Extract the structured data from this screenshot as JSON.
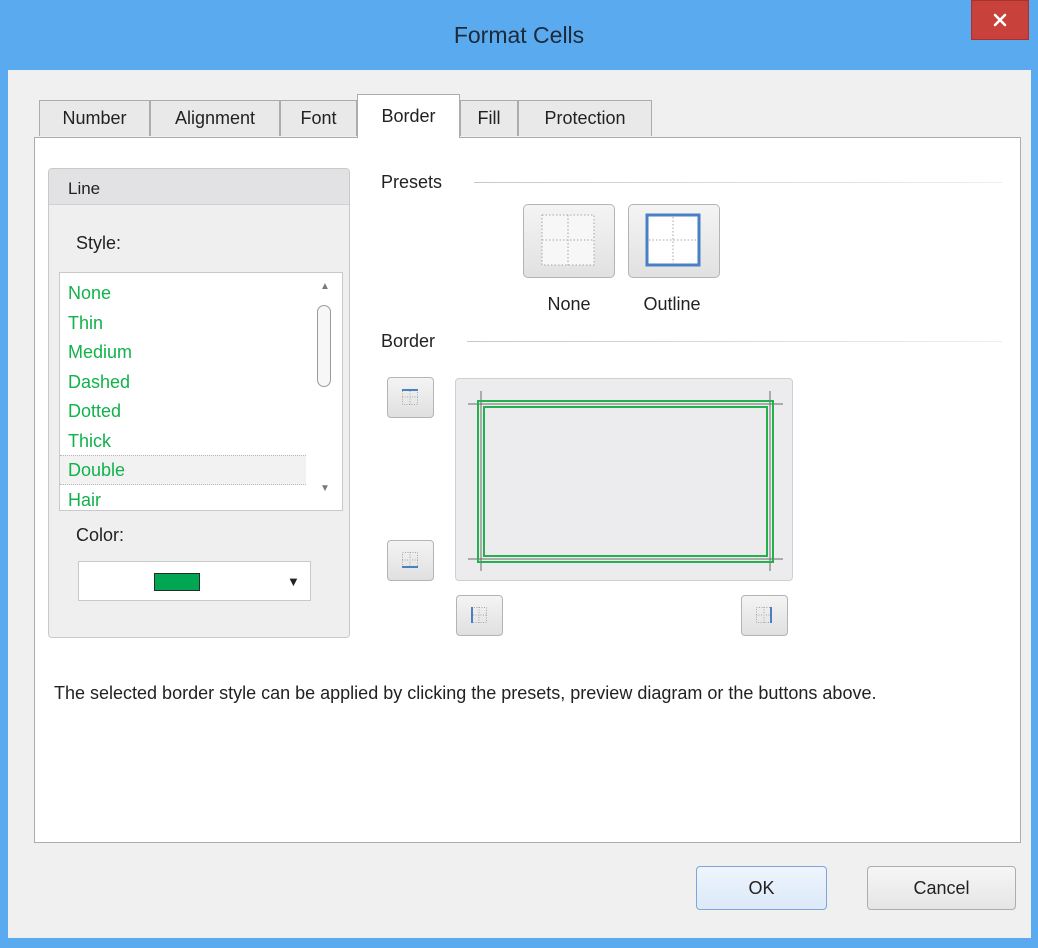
{
  "window": {
    "title": "Format Cells"
  },
  "tabs": [
    {
      "label": "Number"
    },
    {
      "label": "Alignment"
    },
    {
      "label": "Font"
    },
    {
      "label": "Border"
    },
    {
      "label": "Fill"
    },
    {
      "label": "Protection"
    }
  ],
  "active_tab": "Border",
  "line": {
    "header": "Line",
    "style_label": "Style:",
    "styles": [
      "None",
      "Thin",
      "Medium",
      "Dashed",
      "Dotted",
      "Thick",
      "Double",
      "Hair"
    ],
    "selected_style": "Double",
    "color_label": "Color:",
    "color_value": "#00a651"
  },
  "presets": {
    "title": "Presets",
    "none_label": "None",
    "outline_label": "Outline"
  },
  "border": {
    "title": "Border",
    "line_color": "#22b14c"
  },
  "info_text": "The selected border style can be applied by clicking the presets, preview diagram or the buttons above.",
  "buttons": {
    "ok": "OK",
    "cancel": "Cancel"
  },
  "colors": {
    "title_bar": "#5aaaf0",
    "close_button": "#c8413a",
    "list_text": "#10b24a"
  }
}
